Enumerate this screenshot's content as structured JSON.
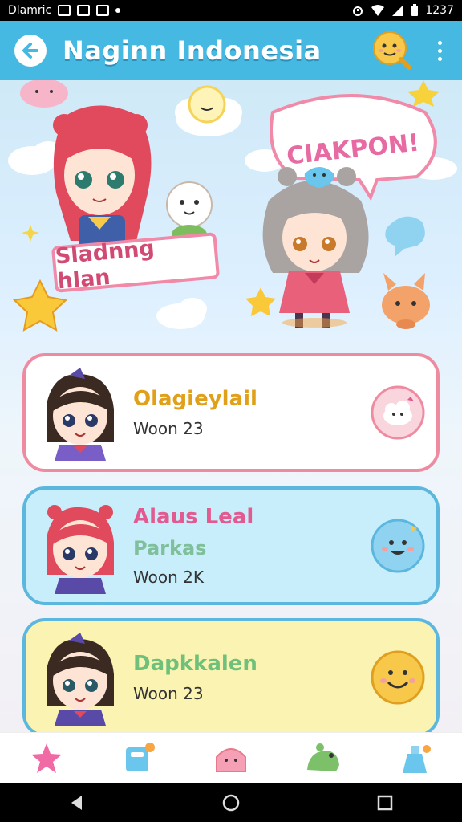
{
  "status_bar": {
    "carrier": "Dlamric",
    "time": "1237"
  },
  "app_bar": {
    "title": "Naginn Indonesia"
  },
  "hero": {
    "name_tag": "Sladnng hlan",
    "speech_bubble": "CIAKPON!"
  },
  "cards": [
    {
      "title": "Olagieylail",
      "subtitle": "",
      "meta": "Woon 23",
      "border_color": "#ef8ba0",
      "bg_color": "#ffffff",
      "badge_icon": "cloud-bunny-icon"
    },
    {
      "title": "Alaus Leal",
      "subtitle": "Parkas",
      "meta": "Woon 2K",
      "border_color": "#5cb7df",
      "bg_color": "#c8eefc",
      "badge_icon": "blue-blob-icon"
    },
    {
      "title": "Dapkkalen",
      "subtitle": "",
      "meta": "Woon 23",
      "border_color": "#5cb7df",
      "bg_color": "#fbf3b1",
      "badge_icon": "smiley-icon"
    }
  ],
  "bottom_nav": {
    "items": [
      {
        "icon": "star-icon"
      },
      {
        "icon": "tag-icon"
      },
      {
        "icon": "home-icon"
      },
      {
        "icon": "frog-icon"
      },
      {
        "icon": "bottle-icon"
      }
    ]
  },
  "colors": {
    "app_bar": "#46b9e2",
    "accent_pink": "#ef8ba0",
    "accent_blue": "#5cb7df"
  }
}
